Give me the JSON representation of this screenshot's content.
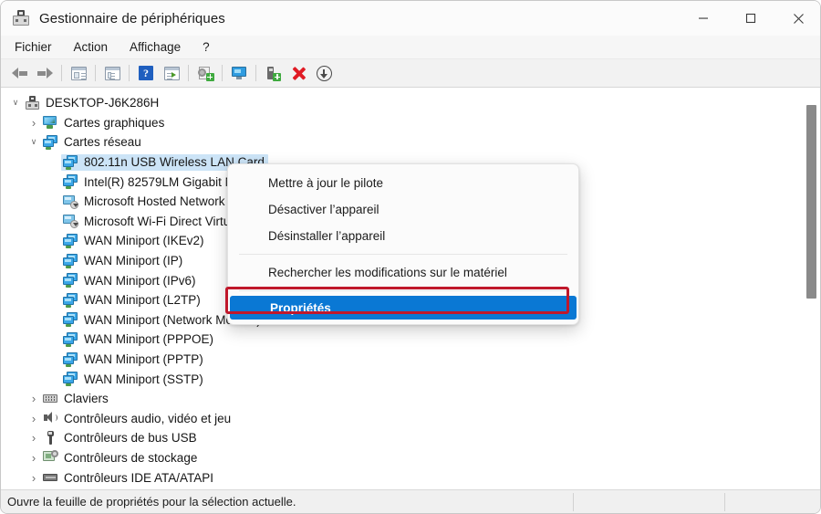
{
  "window": {
    "title": "Gestionnaire de périphériques",
    "icon": "device-manager-icon",
    "controls": {
      "minimize": "minimize-icon",
      "maximize": "maximize-icon",
      "close": "close-icon"
    }
  },
  "menubar": {
    "items": [
      {
        "label": "Fichier"
      },
      {
        "label": "Action"
      },
      {
        "label": "Affichage"
      },
      {
        "label": "?"
      }
    ]
  },
  "toolbar": {
    "buttons": [
      {
        "icon": "back-arrow-icon"
      },
      {
        "icon": "forward-arrow-icon"
      },
      {
        "icon": "show-hide-console-tree-icon"
      },
      {
        "icon": "properties-icon"
      },
      {
        "icon": "help-icon"
      },
      {
        "icon": "update-driver-icon"
      },
      {
        "icon": "uninstall-device-icon"
      },
      {
        "icon": "scan-hardware-changes-icon"
      },
      {
        "icon": "disable-device-icon"
      },
      {
        "icon": "delete-device-icon"
      },
      {
        "icon": "download-icon"
      }
    ]
  },
  "tree": {
    "nodes": [
      {
        "label": "DESKTOP-J6K286H",
        "icon": "computer-icon",
        "depth": 0,
        "chevron": "expanded",
        "selected": false,
        "icon_class": "computer"
      },
      {
        "label": "Cartes graphiques",
        "icon": "display-adapter-icon",
        "depth": 1,
        "chevron": "collapsed",
        "selected": false,
        "icon_class": "display"
      },
      {
        "label": "Cartes réseau",
        "icon": "network-adapter-icon",
        "depth": 1,
        "chevron": "expanded",
        "selected": false,
        "icon_class": "net"
      },
      {
        "label": "802.11n USB Wireless LAN Card",
        "icon": "network-adapter-icon",
        "depth": 2,
        "chevron": "none",
        "selected": true,
        "icon_class": "net"
      },
      {
        "label": "Intel(R) 82579LM Gigabit Network Connection",
        "icon": "network-adapter-icon",
        "depth": 2,
        "chevron": "none",
        "selected": false,
        "icon_class": "net"
      },
      {
        "label": "Microsoft Hosted Network Virtual Adapter",
        "icon": "virtual-network-adapter-icon",
        "depth": 2,
        "chevron": "none",
        "selected": false,
        "icon_class": "vnet"
      },
      {
        "label": "Microsoft Wi-Fi Direct Virtual Adapter",
        "icon": "virtual-network-adapter-icon",
        "depth": 2,
        "chevron": "none",
        "selected": false,
        "icon_class": "vnet"
      },
      {
        "label": "WAN Miniport (IKEv2)",
        "icon": "network-adapter-icon",
        "depth": 2,
        "chevron": "none",
        "selected": false,
        "icon_class": "net"
      },
      {
        "label": "WAN Miniport (IP)",
        "icon": "network-adapter-icon",
        "depth": 2,
        "chevron": "none",
        "selected": false,
        "icon_class": "net"
      },
      {
        "label": "WAN Miniport (IPv6)",
        "icon": "network-adapter-icon",
        "depth": 2,
        "chevron": "none",
        "selected": false,
        "icon_class": "net"
      },
      {
        "label": "WAN Miniport (L2TP)",
        "icon": "network-adapter-icon",
        "depth": 2,
        "chevron": "none",
        "selected": false,
        "icon_class": "net"
      },
      {
        "label": "WAN Miniport (Network Monitor)",
        "icon": "network-adapter-icon",
        "depth": 2,
        "chevron": "none",
        "selected": false,
        "icon_class": "net"
      },
      {
        "label": "WAN Miniport (PPPOE)",
        "icon": "network-adapter-icon",
        "depth": 2,
        "chevron": "none",
        "selected": false,
        "icon_class": "net"
      },
      {
        "label": "WAN Miniport (PPTP)",
        "icon": "network-adapter-icon",
        "depth": 2,
        "chevron": "none",
        "selected": false,
        "icon_class": "net"
      },
      {
        "label": "WAN Miniport (SSTP)",
        "icon": "network-adapter-icon",
        "depth": 2,
        "chevron": "none",
        "selected": false,
        "icon_class": "net"
      },
      {
        "label": "Claviers",
        "icon": "keyboard-icon",
        "depth": 1,
        "chevron": "collapsed",
        "selected": false,
        "icon_class": "keyb"
      },
      {
        "label": "Contrôleurs audio, vidéo et jeu",
        "icon": "audio-icon",
        "depth": 1,
        "chevron": "collapsed",
        "selected": false,
        "icon_class": "audio"
      },
      {
        "label": "Contrôleurs de bus USB",
        "icon": "usb-icon",
        "depth": 1,
        "chevron": "collapsed",
        "selected": false,
        "icon_class": "usb"
      },
      {
        "label": "Contrôleurs de stockage",
        "icon": "storage-controller-icon",
        "depth": 1,
        "chevron": "collapsed",
        "selected": false,
        "icon_class": "storage"
      },
      {
        "label": "Contrôleurs IDE ATA/ATAPI",
        "icon": "ide-controller-icon",
        "depth": 1,
        "chevron": "collapsed",
        "selected": false,
        "icon_class": "ide"
      }
    ]
  },
  "context_menu": {
    "items": [
      {
        "label": "Mettre à jour le pilote",
        "highlighted": false
      },
      {
        "label": "Désactiver l’appareil",
        "highlighted": false
      },
      {
        "label": "Désinstaller l’appareil",
        "highlighted": false
      },
      {
        "separator": true
      },
      {
        "label": "Rechercher les modifications sur le matériel",
        "highlighted": false
      },
      {
        "separator": true
      },
      {
        "label": "Propriétés",
        "highlighted": true
      }
    ],
    "highlight_color": "#0a78d4",
    "annotation_box_color": "#c0182b"
  },
  "statusbar": {
    "text": "Ouvre la feuille de propriétés pour la sélection actuelle."
  }
}
